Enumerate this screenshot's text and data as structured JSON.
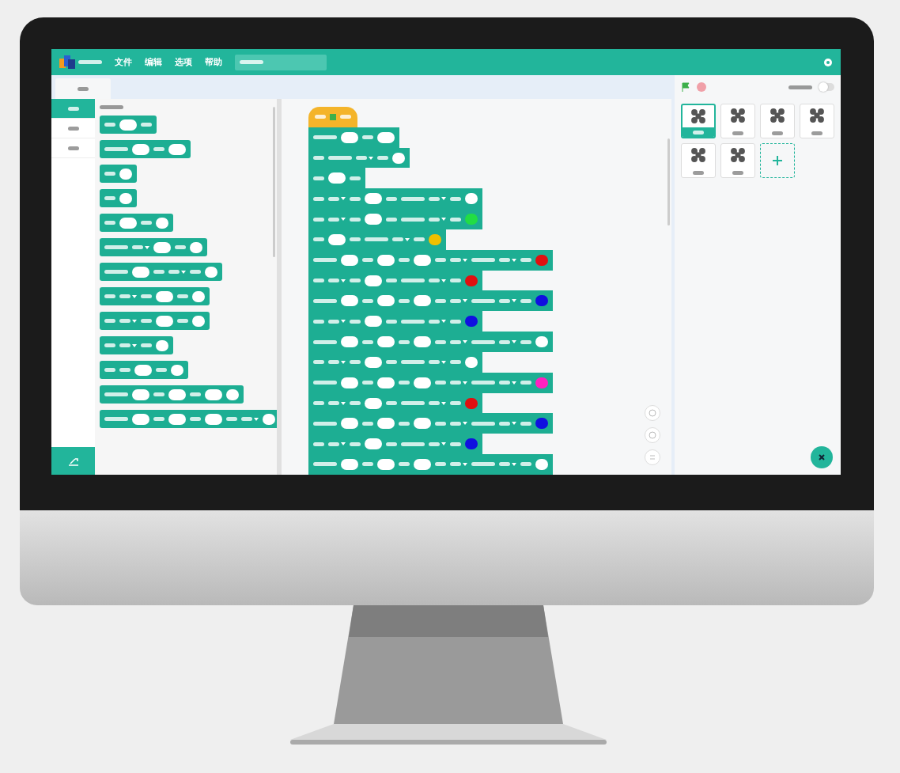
{
  "menu": [
    {
      "label": "文件"
    },
    {
      "label": "编辑"
    },
    {
      "label": "选项"
    },
    {
      "label": "帮助"
    }
  ],
  "categories": [
    {
      "selected": true
    },
    {
      "selected": false
    },
    {
      "selected": false
    }
  ],
  "palette": {
    "blocks": [
      {
        "parts": [
          {
            "kind": "word"
          },
          {
            "kind": "input"
          },
          {
            "kind": "word"
          }
        ]
      },
      {
        "parts": [
          {
            "kind": "phrase"
          },
          {
            "kind": "input"
          },
          {
            "kind": "word"
          },
          {
            "kind": "input"
          }
        ]
      },
      {
        "parts": [
          {
            "kind": "word"
          }
        ],
        "color": "#ffffff"
      },
      {
        "parts": [
          {
            "kind": "word"
          }
        ],
        "color": "#ffffff"
      },
      {
        "parts": [
          {
            "kind": "word"
          },
          {
            "kind": "input"
          },
          {
            "kind": "word"
          }
        ],
        "color": "#ffffff"
      },
      {
        "parts": [
          {
            "kind": "phrase"
          },
          {
            "kind": "menu"
          },
          {
            "kind": "input"
          },
          {
            "kind": "word"
          }
        ],
        "color": "#ffffff"
      },
      {
        "parts": [
          {
            "kind": "phrase"
          },
          {
            "kind": "input"
          },
          {
            "kind": "word"
          },
          {
            "kind": "menu"
          },
          {
            "kind": "word"
          }
        ],
        "color": "#ffffff"
      },
      {
        "parts": [
          {
            "kind": "word"
          },
          {
            "kind": "menu"
          },
          {
            "kind": "word"
          },
          {
            "kind": "input"
          },
          {
            "kind": "word"
          }
        ],
        "color": "#ffffff"
      },
      {
        "parts": [
          {
            "kind": "word"
          },
          {
            "kind": "menu"
          },
          {
            "kind": "word"
          },
          {
            "kind": "input"
          },
          {
            "kind": "word"
          }
        ],
        "color": "#ffffff"
      },
      {
        "parts": [
          {
            "kind": "word"
          },
          {
            "kind": "menu"
          },
          {
            "kind": "word"
          }
        ],
        "color": "#ffffff"
      },
      {
        "parts": [
          {
            "kind": "word"
          },
          {
            "kind": "word"
          },
          {
            "kind": "input"
          },
          {
            "kind": "word"
          }
        ],
        "color": "#ffffff"
      },
      {
        "parts": [
          {
            "kind": "phrase"
          },
          {
            "kind": "input"
          },
          {
            "kind": "word"
          },
          {
            "kind": "input"
          },
          {
            "kind": "word"
          },
          {
            "kind": "input"
          }
        ],
        "color": "#ffffff"
      },
      {
        "parts": [
          {
            "kind": "phrase"
          },
          {
            "kind": "input"
          },
          {
            "kind": "word"
          },
          {
            "kind": "input"
          },
          {
            "kind": "word"
          },
          {
            "kind": "input"
          },
          {
            "kind": "word"
          },
          {
            "kind": "menu"
          }
        ],
        "color": "#ffffff"
      }
    ]
  },
  "script": {
    "blocks": [
      {
        "parts": [
          {
            "kind": "phrase"
          },
          {
            "kind": "input"
          },
          {
            "kind": "word"
          },
          {
            "kind": "input"
          }
        ]
      },
      {
        "parts": [
          {
            "kind": "word"
          },
          {
            "kind": "phrase"
          },
          {
            "kind": "menu"
          },
          {
            "kind": "word"
          }
        ],
        "color": "#ffffff"
      },
      {
        "parts": [
          {
            "kind": "word"
          },
          {
            "kind": "input"
          },
          {
            "kind": "word"
          }
        ]
      },
      {
        "parts": [
          {
            "kind": "word"
          },
          {
            "kind": "menu"
          },
          {
            "kind": "word"
          },
          {
            "kind": "input"
          },
          {
            "kind": "word"
          },
          {
            "kind": "phrase"
          },
          {
            "kind": "menu"
          },
          {
            "kind": "word"
          }
        ],
        "color": "#ffffff"
      },
      {
        "parts": [
          {
            "kind": "word"
          },
          {
            "kind": "menu"
          },
          {
            "kind": "word"
          },
          {
            "kind": "input"
          },
          {
            "kind": "word"
          },
          {
            "kind": "phrase"
          },
          {
            "kind": "menu"
          },
          {
            "kind": "word"
          }
        ],
        "color": "#22dd44"
      },
      {
        "parts": [
          {
            "kind": "word"
          },
          {
            "kind": "input"
          },
          {
            "kind": "word"
          },
          {
            "kind": "phrase"
          },
          {
            "kind": "menu"
          },
          {
            "kind": "word"
          }
        ],
        "color": "#f0c000"
      },
      {
        "parts": [
          {
            "kind": "phrase"
          },
          {
            "kind": "input"
          },
          {
            "kind": "word"
          },
          {
            "kind": "input"
          },
          {
            "kind": "word"
          },
          {
            "kind": "input"
          },
          {
            "kind": "word"
          },
          {
            "kind": "menu"
          },
          {
            "kind": "phrase"
          },
          {
            "kind": "menu"
          },
          {
            "kind": "word"
          }
        ],
        "color": "#e01010"
      },
      {
        "parts": [
          {
            "kind": "word"
          },
          {
            "kind": "menu"
          },
          {
            "kind": "word"
          },
          {
            "kind": "input"
          },
          {
            "kind": "word"
          },
          {
            "kind": "phrase"
          },
          {
            "kind": "menu"
          },
          {
            "kind": "word"
          }
        ],
        "color": "#e01010"
      },
      {
        "parts": [
          {
            "kind": "phrase"
          },
          {
            "kind": "input"
          },
          {
            "kind": "word"
          },
          {
            "kind": "input"
          },
          {
            "kind": "word"
          },
          {
            "kind": "input"
          },
          {
            "kind": "word"
          },
          {
            "kind": "menu"
          },
          {
            "kind": "phrase"
          },
          {
            "kind": "menu"
          },
          {
            "kind": "word"
          }
        ],
        "color": "#1010e0"
      },
      {
        "parts": [
          {
            "kind": "word"
          },
          {
            "kind": "menu"
          },
          {
            "kind": "word"
          },
          {
            "kind": "input"
          },
          {
            "kind": "word"
          },
          {
            "kind": "phrase"
          },
          {
            "kind": "menu"
          },
          {
            "kind": "word"
          }
        ],
        "color": "#1010e0"
      },
      {
        "parts": [
          {
            "kind": "phrase"
          },
          {
            "kind": "input"
          },
          {
            "kind": "word"
          },
          {
            "kind": "input"
          },
          {
            "kind": "word"
          },
          {
            "kind": "input"
          },
          {
            "kind": "word"
          },
          {
            "kind": "menu"
          },
          {
            "kind": "phrase"
          },
          {
            "kind": "menu"
          },
          {
            "kind": "word"
          }
        ],
        "color": "#ffffff"
      },
      {
        "parts": [
          {
            "kind": "word"
          },
          {
            "kind": "menu"
          },
          {
            "kind": "word"
          },
          {
            "kind": "input"
          },
          {
            "kind": "word"
          },
          {
            "kind": "phrase"
          },
          {
            "kind": "menu"
          },
          {
            "kind": "word"
          }
        ],
        "color": "#ffffff"
      },
      {
        "parts": [
          {
            "kind": "phrase"
          },
          {
            "kind": "input"
          },
          {
            "kind": "word"
          },
          {
            "kind": "input"
          },
          {
            "kind": "word"
          },
          {
            "kind": "input"
          },
          {
            "kind": "word"
          },
          {
            "kind": "menu"
          },
          {
            "kind": "phrase"
          },
          {
            "kind": "menu"
          },
          {
            "kind": "word"
          }
        ],
        "color": "#ff20c0"
      },
      {
        "parts": [
          {
            "kind": "word"
          },
          {
            "kind": "menu"
          },
          {
            "kind": "word"
          },
          {
            "kind": "input"
          },
          {
            "kind": "word"
          },
          {
            "kind": "phrase"
          },
          {
            "kind": "menu"
          },
          {
            "kind": "word"
          }
        ],
        "color": "#e01010"
      },
      {
        "parts": [
          {
            "kind": "phrase"
          },
          {
            "kind": "input"
          },
          {
            "kind": "word"
          },
          {
            "kind": "input"
          },
          {
            "kind": "word"
          },
          {
            "kind": "input"
          },
          {
            "kind": "word"
          },
          {
            "kind": "menu"
          },
          {
            "kind": "phrase"
          },
          {
            "kind": "menu"
          },
          {
            "kind": "word"
          }
        ],
        "color": "#1010e0"
      },
      {
        "parts": [
          {
            "kind": "word"
          },
          {
            "kind": "menu"
          },
          {
            "kind": "word"
          },
          {
            "kind": "input"
          },
          {
            "kind": "word"
          },
          {
            "kind": "phrase"
          },
          {
            "kind": "menu"
          },
          {
            "kind": "word"
          }
        ],
        "color": "#1010e0"
      },
      {
        "parts": [
          {
            "kind": "phrase"
          },
          {
            "kind": "input"
          },
          {
            "kind": "word"
          },
          {
            "kind": "input"
          },
          {
            "kind": "word"
          },
          {
            "kind": "input"
          },
          {
            "kind": "word"
          },
          {
            "kind": "menu"
          },
          {
            "kind": "phrase"
          },
          {
            "kind": "menu"
          },
          {
            "kind": "word"
          }
        ],
        "color": "#ffffff"
      }
    ]
  },
  "toggle": {
    "on": false
  },
  "sprites": [
    {
      "selected": true
    },
    {
      "selected": false
    },
    {
      "selected": false
    },
    {
      "selected": false
    },
    {
      "selected": false
    },
    {
      "selected": false
    }
  ]
}
